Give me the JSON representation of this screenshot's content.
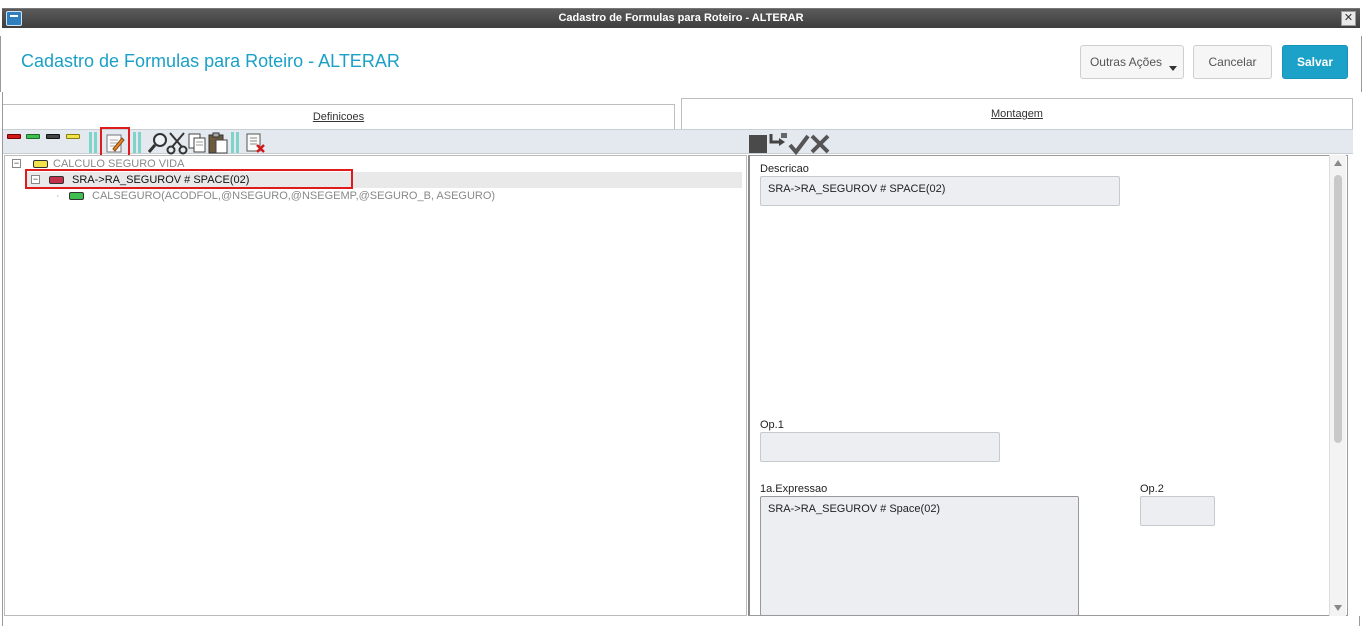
{
  "window": {
    "title": "Cadastro de Formulas para Roteiro - ALTERAR",
    "close_glyph": "✕"
  },
  "header": {
    "title": "Cadastro de Formulas para Roteiro - ALTERAR",
    "buttons": {
      "outras": "Outras Ações",
      "cancelar": "Cancelar",
      "salvar": "Salvar"
    },
    "accent_color": "#1aa0c6"
  },
  "tabs": [
    {
      "label": "Definicoes",
      "active": false
    },
    {
      "label": "Montagem",
      "active": true
    }
  ],
  "tree": {
    "root": {
      "label": "CALCULO SEGURO VIDA",
      "expander": "−",
      "pill_color": "#f2e24a"
    },
    "child": {
      "label": "SRA->RA_SEGUROV # SPACE(02)",
      "expander": "−",
      "pill_color": "#c4304a"
    },
    "leaf": {
      "label": "CALSEGURO(ACODFOL,@NSEGURO,@NSEGEMP,@SEGURO_B, ASEGURO)",
      "pill_color": "#3fbf4f"
    }
  },
  "form": {
    "descricao_label": "Descricao",
    "descricao_value": "SRA->RA_SEGUROV # SPACE(02)",
    "op1_label": "Op.1",
    "op1_value": "",
    "expressao_label": "1a.Expressao",
    "expressao_value": "SRA->RA_SEGUROV # Space(02)",
    "op2_label": "Op.2",
    "op2_value": ""
  }
}
